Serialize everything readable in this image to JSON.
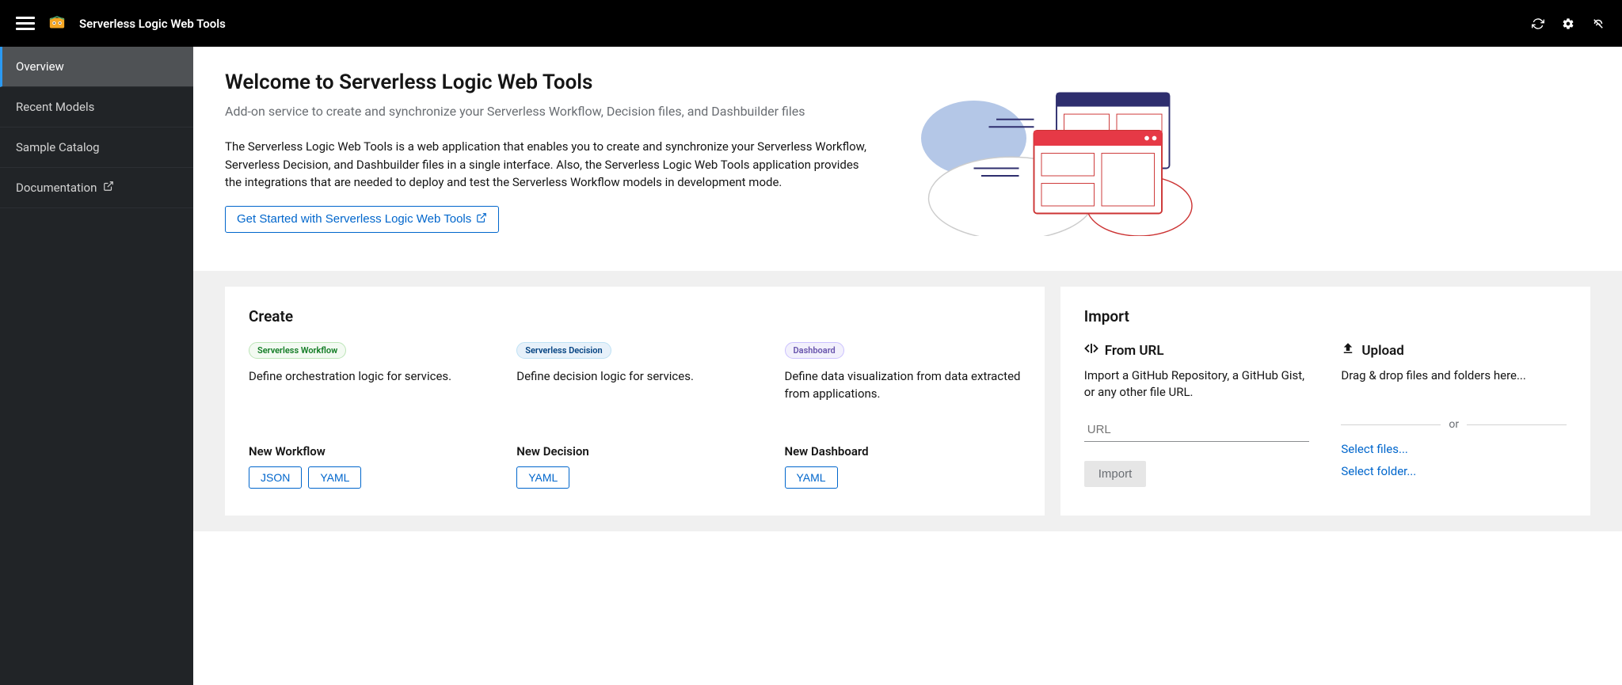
{
  "app_title": "Serverless Logic Web Tools",
  "sidebar": {
    "items": [
      {
        "label": "Overview",
        "active": true,
        "external": false
      },
      {
        "label": "Recent Models",
        "active": false,
        "external": false
      },
      {
        "label": "Sample Catalog",
        "active": false,
        "external": false
      },
      {
        "label": "Documentation",
        "active": false,
        "external": true
      }
    ]
  },
  "hero": {
    "title": "Welcome to Serverless Logic Web Tools",
    "subtitle": "Add-on service to create and synchronize your Serverless Workflow, Decision files, and Dashbuilder files",
    "description": "The Serverless Logic Web Tools is a web application that enables you to create and synchronize your Serverless Workflow, Serverless Decision, and Dashbuilder files in a single interface. Also, the Serverless Logic Web Tools application provides the integrations that are needed to deploy and test the Serverless Workflow models in development mode.",
    "cta": "Get Started with Serverless Logic Web Tools"
  },
  "create": {
    "title": "Create",
    "workflow": {
      "tag": "Serverless Workflow",
      "desc": "Define orchestration logic for services.",
      "new_label": "New Workflow",
      "buttons": [
        "JSON",
        "YAML"
      ]
    },
    "decision": {
      "tag": "Serverless Decision",
      "desc": "Define decision logic for services.",
      "new_label": "New Decision",
      "buttons": [
        "YAML"
      ]
    },
    "dashboard": {
      "tag": "Dashboard",
      "desc": "Define data visualization from data extracted from applications.",
      "new_label": "New Dashboard",
      "buttons": [
        "YAML"
      ]
    }
  },
  "import": {
    "title": "Import",
    "from_url": {
      "heading": "From URL",
      "desc": "Import a GitHub Repository, a GitHub Gist, or any other file URL.",
      "placeholder": "URL",
      "button": "Import"
    },
    "upload": {
      "heading": "Upload",
      "desc": "Drag & drop files and folders here...",
      "or": "or",
      "select_files": "Select files...",
      "select_folder": "Select folder..."
    }
  }
}
